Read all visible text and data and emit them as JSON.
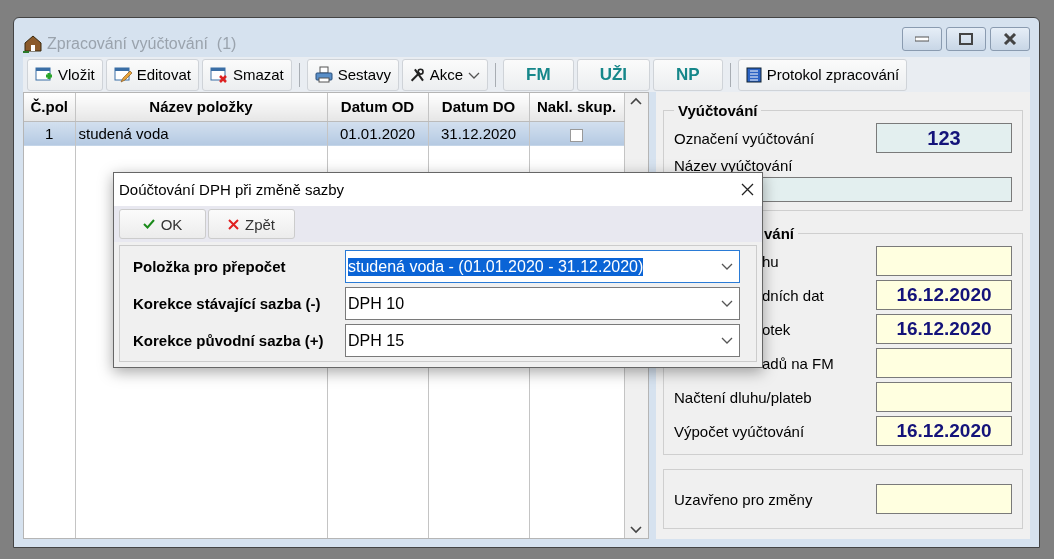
{
  "window": {
    "title": "Zpracování vyúčtování  (1)"
  },
  "toolbar": [
    {
      "kind": "insert",
      "label": "Vložit"
    },
    {
      "kind": "edit",
      "label": "Editovat"
    },
    {
      "kind": "delete",
      "label": "Smazat"
    },
    {
      "kind": "separator"
    },
    {
      "kind": "print",
      "label": "Sestavy"
    },
    {
      "kind": "tools",
      "label": "Akce"
    },
    {
      "kind": "separator"
    },
    {
      "kind": "code",
      "label": "FM"
    },
    {
      "kind": "code",
      "label": "UŽI"
    },
    {
      "kind": "code",
      "label": "NP"
    },
    {
      "kind": "separator"
    },
    {
      "kind": "list",
      "label": "Protokol zpracování"
    }
  ],
  "table": {
    "columns": [
      "Č.pol",
      "Název položky",
      "Datum OD",
      "Datum DO",
      "Nakl. skup."
    ],
    "rows": [
      {
        "number": "1",
        "name": "studená voda",
        "from": "01.01.2020",
        "to": "31.12.2020",
        "checked": false,
        "selected": true
      }
    ]
  },
  "groups": [
    {
      "kind": "info",
      "title": "Vyúčtování",
      "fields": [
        {
          "kind": "inline",
          "label": "Označení vyúčtování",
          "value": "123"
        },
        {
          "kind": "stacked",
          "label": "Název vyúčtování"
        }
      ]
    },
    {
      "kind": "status",
      "title": "vání",
      "fields": [
        {
          "kind": "covered",
          "label": "hu"
        },
        {
          "kind": "covered",
          "label": "dních dat",
          "value": "16.12.2020"
        },
        {
          "kind": "covered",
          "label": "otek",
          "value": "16.12.2020"
        },
        {
          "kind": "covered",
          "label": "adů na FM"
        },
        {
          "kind": "inline",
          "label": "Načtení dluhu/plateb"
        },
        {
          "kind": "inline",
          "label": "Výpočet vyúčtování",
          "value": "16.12.2020"
        }
      ]
    },
    {
      "kind": "status",
      "fields": [
        {
          "kind": "inline",
          "label": "Uzavřeno pro změny"
        }
      ]
    }
  ],
  "dialog": {
    "title": "Doúčtování DPH při změně sazby",
    "buttons": [
      {
        "kind": "ok",
        "label": "OK"
      },
      {
        "kind": "cancel",
        "label": "Zpět"
      }
    ],
    "fields": [
      {
        "label": "Položka pro přepočet",
        "value": "studená voda - (01.01.2020 - 31.12.2020)",
        "focused": true
      },
      {
        "label": "Korekce stávající sazba (-)",
        "value": "DPH 10",
        "focused": false
      },
      {
        "label": "Korekce původní sazba (+)",
        "value": "DPH 15",
        "focused": false
      }
    ]
  }
}
